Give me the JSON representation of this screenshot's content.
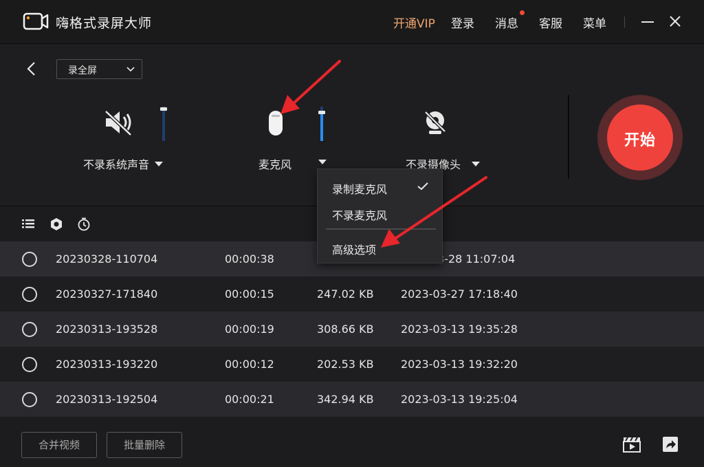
{
  "app": {
    "title": "嗨格式录屏大师"
  },
  "nav": {
    "vip": "开通VIP",
    "login": "登录",
    "messages": "消息",
    "service": "客服",
    "menu": "菜单"
  },
  "mode": {
    "selected": "录全屏"
  },
  "sources": {
    "system_audio": {
      "label": "不录系统声音",
      "level": 0.0
    },
    "microphone": {
      "label": "麦克风",
      "level": 0.8
    },
    "camera": {
      "label": "不录摄像头"
    }
  },
  "start": {
    "label": "开始"
  },
  "mic_menu": {
    "items": [
      {
        "label": "录制麦克风",
        "checked": true
      },
      {
        "label": "不录麦克风",
        "checked": false
      },
      {
        "label": "高级选项",
        "checked": false
      }
    ]
  },
  "recordings": [
    {
      "name": "20230328-110704",
      "duration": "00:00:38",
      "size": "",
      "date": "3-28 11:07:04"
    },
    {
      "name": "20230327-171840",
      "duration": "00:00:15",
      "size": "247.02 KB",
      "date": "2023-03-27 17:18:40"
    },
    {
      "name": "20230313-193528",
      "duration": "00:00:19",
      "size": "308.66 KB",
      "date": "2023-03-13 19:35:28"
    },
    {
      "name": "20230313-193220",
      "duration": "00:00:12",
      "size": "202.53 KB",
      "date": "2023-03-13 19:32:20"
    },
    {
      "name": "20230313-192504",
      "duration": "00:00:21",
      "size": "342.94 KB",
      "date": "2023-03-13 19:25:04"
    }
  ],
  "bottom": {
    "merge_label": "合并视频",
    "batch_delete_label": "批量删除"
  },
  "colors": {
    "accent": "#f0423c",
    "vip": "#f0a56b",
    "slider_fill": "#2b8cf0",
    "annotation_arrow": "#e8262b"
  }
}
